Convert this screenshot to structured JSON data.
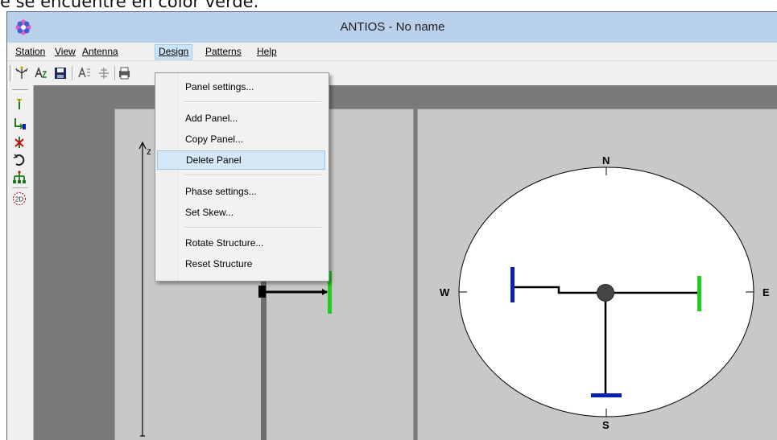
{
  "caption": "e se encuentre en color verde.",
  "window": {
    "title": "ANTIOS - No name"
  },
  "menubar": {
    "items": [
      {
        "label": "Station"
      },
      {
        "label": "View"
      },
      {
        "label": "Antenna"
      },
      {
        "label": "Design"
      },
      {
        "label": "Patterns"
      },
      {
        "label": "Help"
      }
    ]
  },
  "design_menu": {
    "items": [
      {
        "label": "Panel settings..."
      },
      {
        "label": "Add Panel..."
      },
      {
        "label": "Copy Panel..."
      },
      {
        "label": "Delete Panel"
      },
      {
        "label": "Phase settings..."
      },
      {
        "label": "Set Skew..."
      },
      {
        "label": "Rotate Structure..."
      },
      {
        "label": "Reset Structure"
      }
    ]
  },
  "elevation_view": {
    "axis_label": "z"
  },
  "plan_view": {
    "compass": {
      "north": "N",
      "south": "S",
      "west": "W",
      "east": "E"
    }
  },
  "colors": {
    "titlebar": "#b9d1ea",
    "panel_green": "#22cc22",
    "panel_blue": "#0a1fb4",
    "workspace_bg": "#7a7a7a",
    "pane_bg": "#c8c8c8",
    "menu_highlight": "#d6e8f7"
  },
  "toolbar_icons": [
    "antenna-add-icon",
    "antenna-label-icon",
    "save-icon",
    "antenna-edit-icon",
    "grid-icon",
    "print-icon"
  ],
  "side_toolbar_icons": [
    "dipole-icon",
    "route-icon",
    "delete-element-icon",
    "rotate-icon",
    "array-icon",
    "view-2d-icon"
  ],
  "side_toolbar_2d_label": "2D"
}
